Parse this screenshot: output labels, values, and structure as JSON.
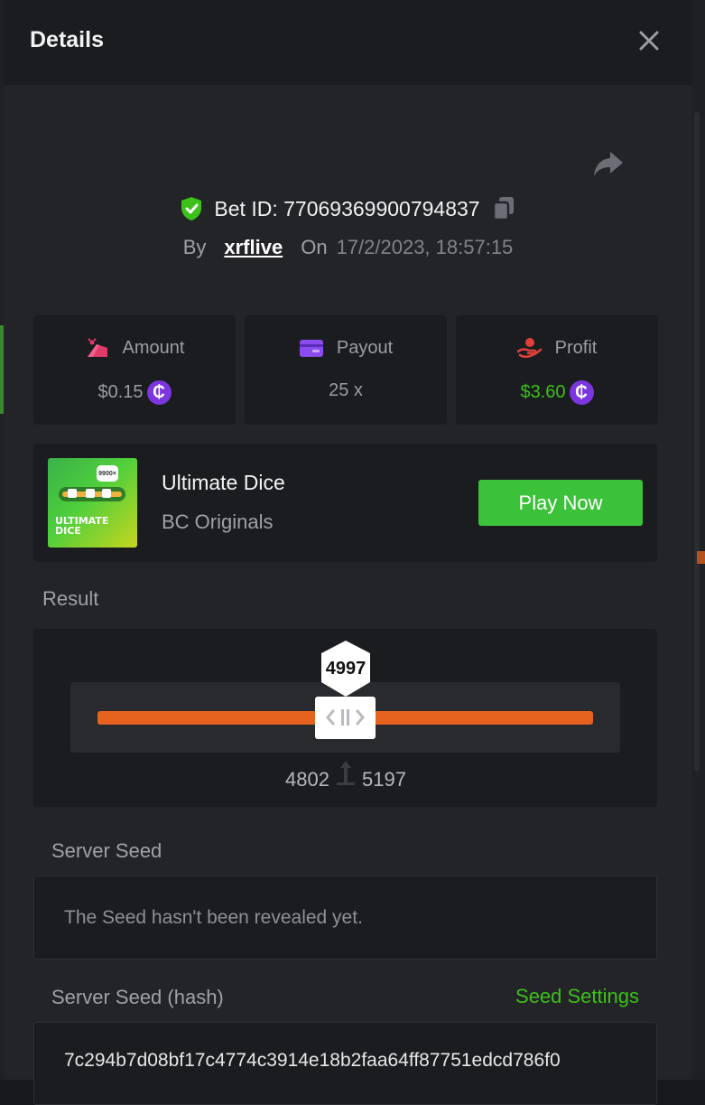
{
  "modal": {
    "title": "Details",
    "close_icon": "close-icon",
    "share_icon": "share-icon"
  },
  "bet": {
    "verified_icon": "shield-check-icon",
    "id_label": "Bet ID: 77069369900794837",
    "copy_icon": "copy-icon",
    "by_label": "By",
    "user": "xrflive",
    "on_label": "On",
    "datetime": "17/2/2023, 18:57:15"
  },
  "stats": [
    {
      "icon": "amount-icon",
      "label": "Amount",
      "value": "$0.15",
      "coin": "₵",
      "color": "#e03a6a"
    },
    {
      "icon": "payout-icon",
      "label": "Payout",
      "value": "25 x",
      "color": "#8a4cf0"
    },
    {
      "icon": "profit-icon",
      "label": "Profit",
      "value": "$3.60",
      "coin": "₵",
      "color": "#e0403a"
    }
  ],
  "game": {
    "thumb_text": "ULTIMATE DICE",
    "thumb_badge": "9900×",
    "name": "Ultimate Dice",
    "provider": "BC Originals",
    "play_label": "Play Now"
  },
  "result": {
    "label": "Result",
    "value": "4997",
    "range_low": "4802",
    "range_high": "5197",
    "accent": "#e5621f"
  },
  "server_seed": {
    "label": "Server Seed",
    "text": "The Seed hasn't been revealed yet."
  },
  "server_seed_hash": {
    "label": "Server Seed (hash)",
    "settings_label": "Seed Settings",
    "hash": "7c294b7d08bf17c4774c3914e18b2faa64ff87751edcd786f0"
  },
  "colors": {
    "accent_green": "#3bc117",
    "coin_purple": "#7b36e0"
  }
}
